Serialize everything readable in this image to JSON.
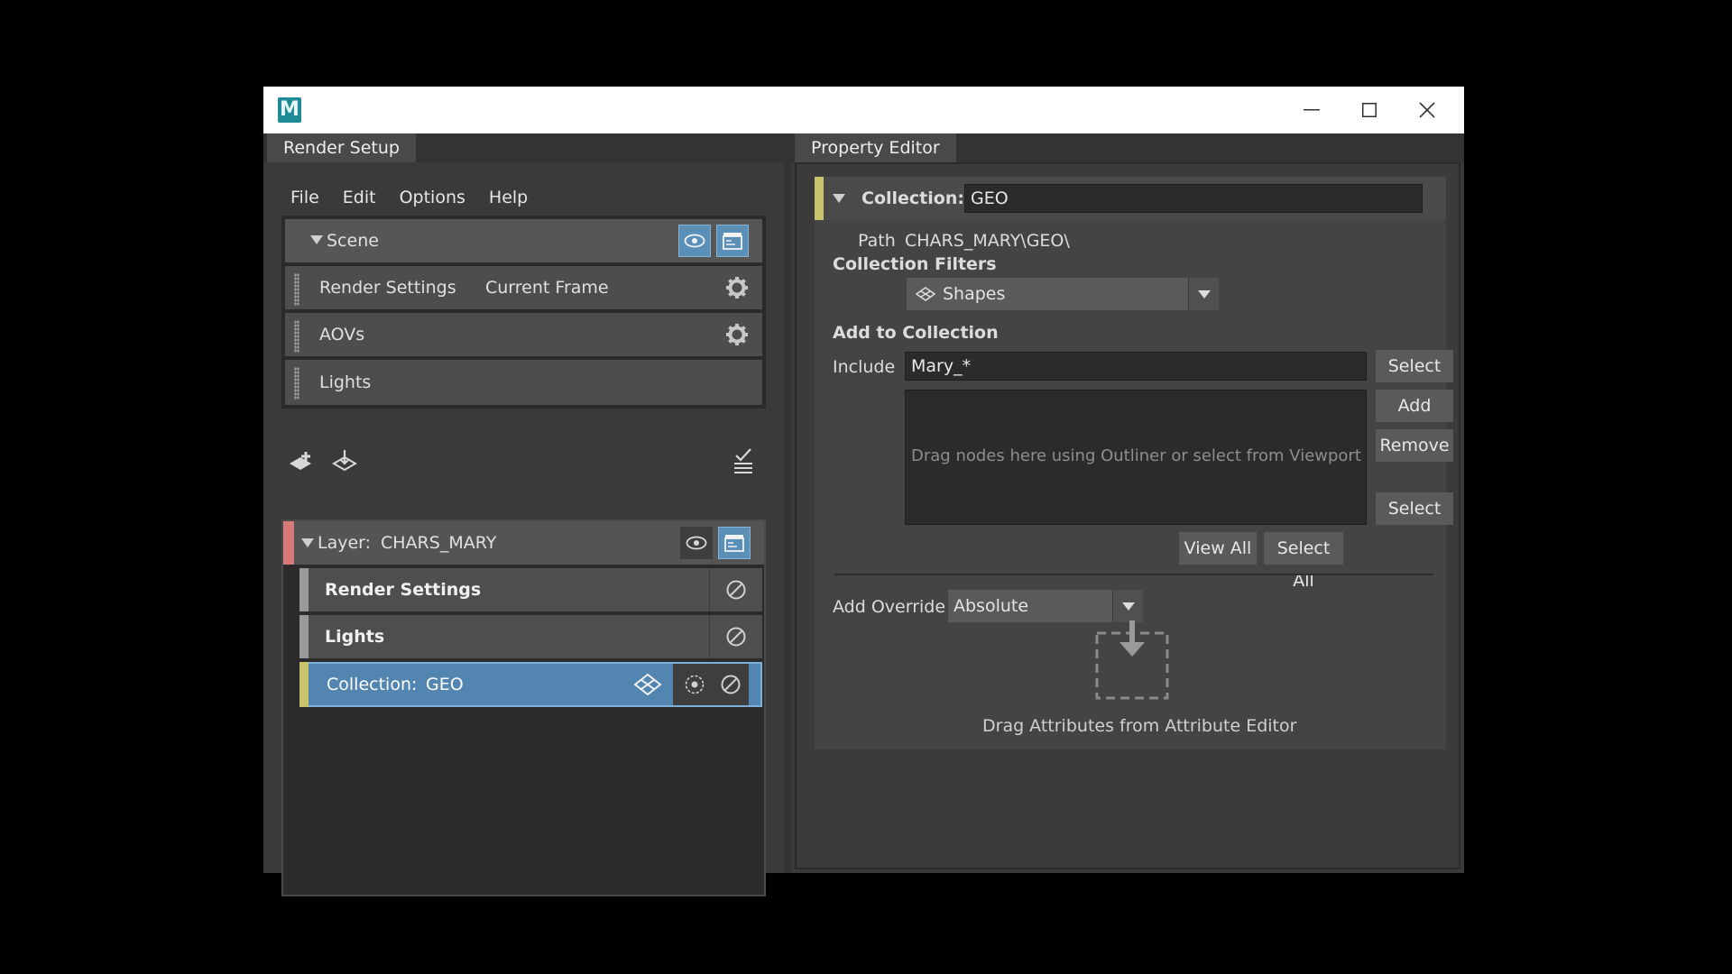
{
  "app": {
    "logo_letter": "M"
  },
  "left": {
    "tab": "Render Setup",
    "menu": [
      "File",
      "Edit",
      "Options",
      "Help"
    ],
    "scene": {
      "title": "Scene",
      "rows": [
        {
          "label": "Render Settings",
          "value": "Current Frame"
        },
        {
          "label": "AOVs",
          "value": ""
        },
        {
          "label": "Lights",
          "value": ""
        }
      ]
    },
    "layer": {
      "prefix": "Layer:",
      "name": "CHARS_MARY",
      "children": [
        {
          "label": "Render Settings"
        },
        {
          "label": "Lights"
        }
      ],
      "collection": {
        "prefix": "Collection:",
        "name": "GEO"
      }
    }
  },
  "right": {
    "tab": "Property Editor",
    "collection_label": "Collection:",
    "collection_name": "GEO",
    "path_label": "Path",
    "path_value": "CHARS_MARY\\GEO\\",
    "filters_heading": "Collection Filters",
    "filter_value": "Shapes",
    "add_heading": "Add to Collection",
    "include_label": "Include",
    "include_value": "Mary_*",
    "buttons": {
      "select_top": "Select",
      "add": "Add",
      "remove": "Remove",
      "select_bottom": "Select",
      "view_all": "View All",
      "select_all": "Select All"
    },
    "drop_hint": "Drag nodes here using Outliner or select from Viewport",
    "override_label": "Add Override",
    "override_value": "Absolute",
    "attr_hint": "Drag Attributes from Attribute Editor"
  },
  "colors": {
    "accent_blue": "#5a8fb8",
    "layer_tag": "#d97a7a",
    "collection_tag": "#c9c46b",
    "selected_row": "#5285b0"
  }
}
